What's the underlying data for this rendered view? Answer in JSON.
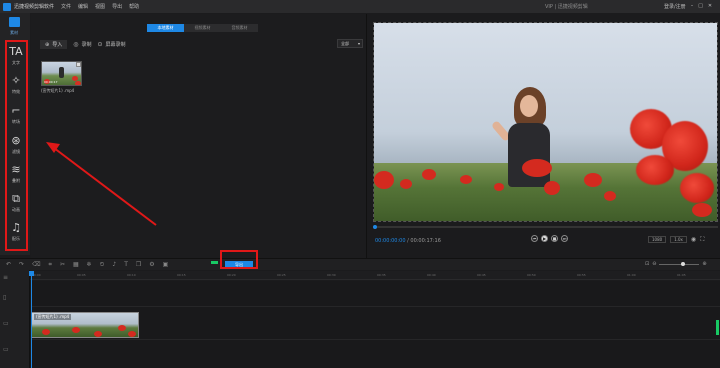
{
  "titlebar": {
    "app_name": "迅捷视频剪辑软件",
    "menu": [
      "文件",
      "编辑",
      "视图",
      "导出",
      "帮助"
    ],
    "center_text": "VIP | 迅捷视频剪辑",
    "right_text": "登录/注册"
  },
  "left_toolbar": {
    "media_label": "素材",
    "tools": [
      {
        "label": "文字",
        "icon": "text-icon",
        "glyph": "TA"
      },
      {
        "label": "特效",
        "icon": "sparkle-icon",
        "glyph": "✧"
      },
      {
        "label": "转场",
        "icon": "transition-icon",
        "glyph": "⌐"
      },
      {
        "label": "滤镜",
        "icon": "filter-icon",
        "glyph": "⊛"
      },
      {
        "label": "叠附",
        "icon": "layers-icon",
        "glyph": "≋"
      },
      {
        "label": "动画",
        "icon": "animation-icon",
        "glyph": "⧉"
      },
      {
        "label": "配乐",
        "icon": "music-icon",
        "glyph": "♫"
      }
    ]
  },
  "media_panel": {
    "tabs": [
      "本地素材",
      "视频素材",
      "音频素材"
    ],
    "import_label": "导入",
    "record_label": "录制",
    "record_screen_label": "屏幕录制",
    "sort_value": "全部",
    "items": [
      {
        "name": "(宣传短片1) .mp4",
        "duration": "00:00:17"
      }
    ]
  },
  "preview": {
    "current_time": "00:00:00:00",
    "total_time": "/ 00:00:17:16",
    "quality": "1080",
    "speed": "1.0x",
    "brand_colors": {
      "accent": "#1e88e5",
      "highlight": "#e01818"
    }
  },
  "timeline": {
    "export_label": "导出",
    "clip_label": "(宣传短片1) .mp4",
    "ruler": [
      "00:00",
      "00:05",
      "00:10",
      "00:15",
      "00:20",
      "00:25",
      "00:30",
      "00:35",
      "00:40",
      "00:45",
      "00:50",
      "00:55",
      "01:00",
      "01:05"
    ]
  }
}
